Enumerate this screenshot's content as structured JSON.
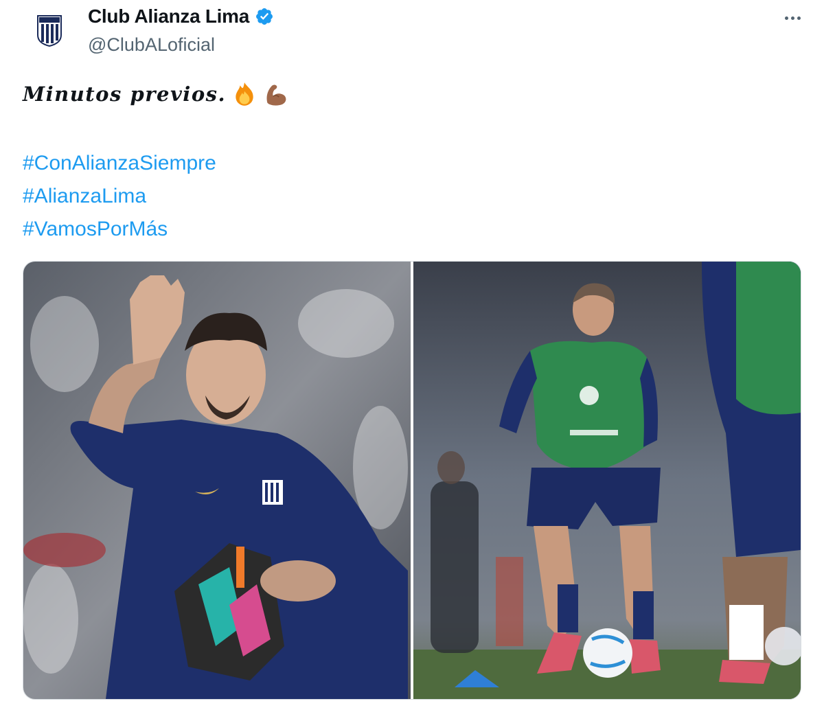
{
  "author": {
    "display_name": "Club Alianza Lima",
    "handle": "@ClubALoficial",
    "verified": true,
    "avatar_icon": "alianza-lima-crest-icon"
  },
  "menu": {
    "icon": "more-options-icon"
  },
  "tweet": {
    "text": "Minutos previos.",
    "emojis": [
      "fire-emoji",
      "flexed-biceps-emoji"
    ],
    "hashtags": [
      "#ConAlianzaSiempre",
      "#AlianzaLima",
      "#VamosPorMás"
    ]
  },
  "media": [
    {
      "icon": "goalkeeper-waving-photo"
    },
    {
      "icon": "players-warming-up-photo"
    }
  ],
  "colors": {
    "accent": "#1d9bf0",
    "text": "#0f1419",
    "muted": "#536471",
    "navy": "#1e2f6b",
    "bib_green": "#2f8a4f"
  }
}
